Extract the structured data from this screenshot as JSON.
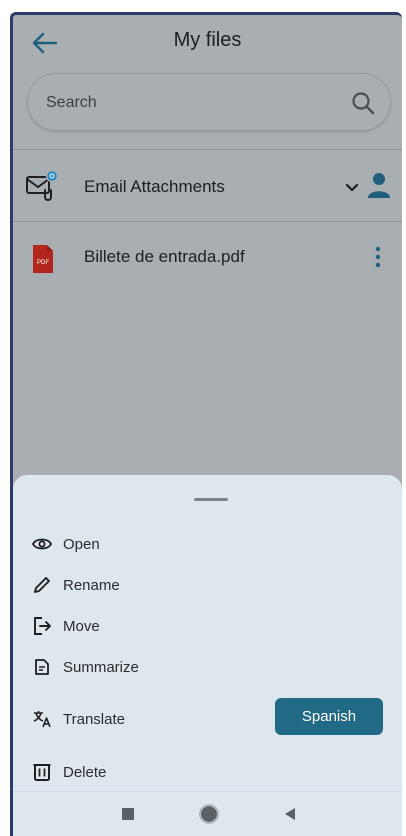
{
  "header": {
    "title": "My files",
    "back_icon": "arrow-left-icon"
  },
  "search": {
    "placeholder": "Search",
    "value": "",
    "icon": "search-icon"
  },
  "folder": {
    "label": "Email Attachments",
    "icon": "mail-attachment-icon",
    "badge_color": "#2a86c4",
    "user_icon": "person-icon",
    "expand_icon": "chevron-down-icon"
  },
  "files": [
    {
      "name": "Billete de entrada.pdf",
      "type": "pdf",
      "icon_label": "PDF",
      "menu_icon": "more-vert-icon"
    }
  ],
  "sheet": {
    "items": [
      {
        "label": "Open",
        "icon": "eye-icon"
      },
      {
        "label": "Rename",
        "icon": "pencil-icon"
      },
      {
        "label": "Move",
        "icon": "move-icon"
      },
      {
        "label": "Summarize",
        "icon": "summarize-icon"
      },
      {
        "label": "Translate",
        "icon": "translate-icon"
      },
      {
        "label": "Delete",
        "icon": "trash-icon"
      }
    ],
    "translate_language": "Spanish"
  },
  "navbar": {
    "items": [
      "recents-icon",
      "home-icon",
      "back-icon"
    ]
  },
  "colors": {
    "accent": "#216a85",
    "pdf_red": "#b3261e",
    "sheet_bg": "#dfe7ee",
    "dim_bg": "#a9aeb2",
    "user_icon": "#1f5f7b"
  }
}
